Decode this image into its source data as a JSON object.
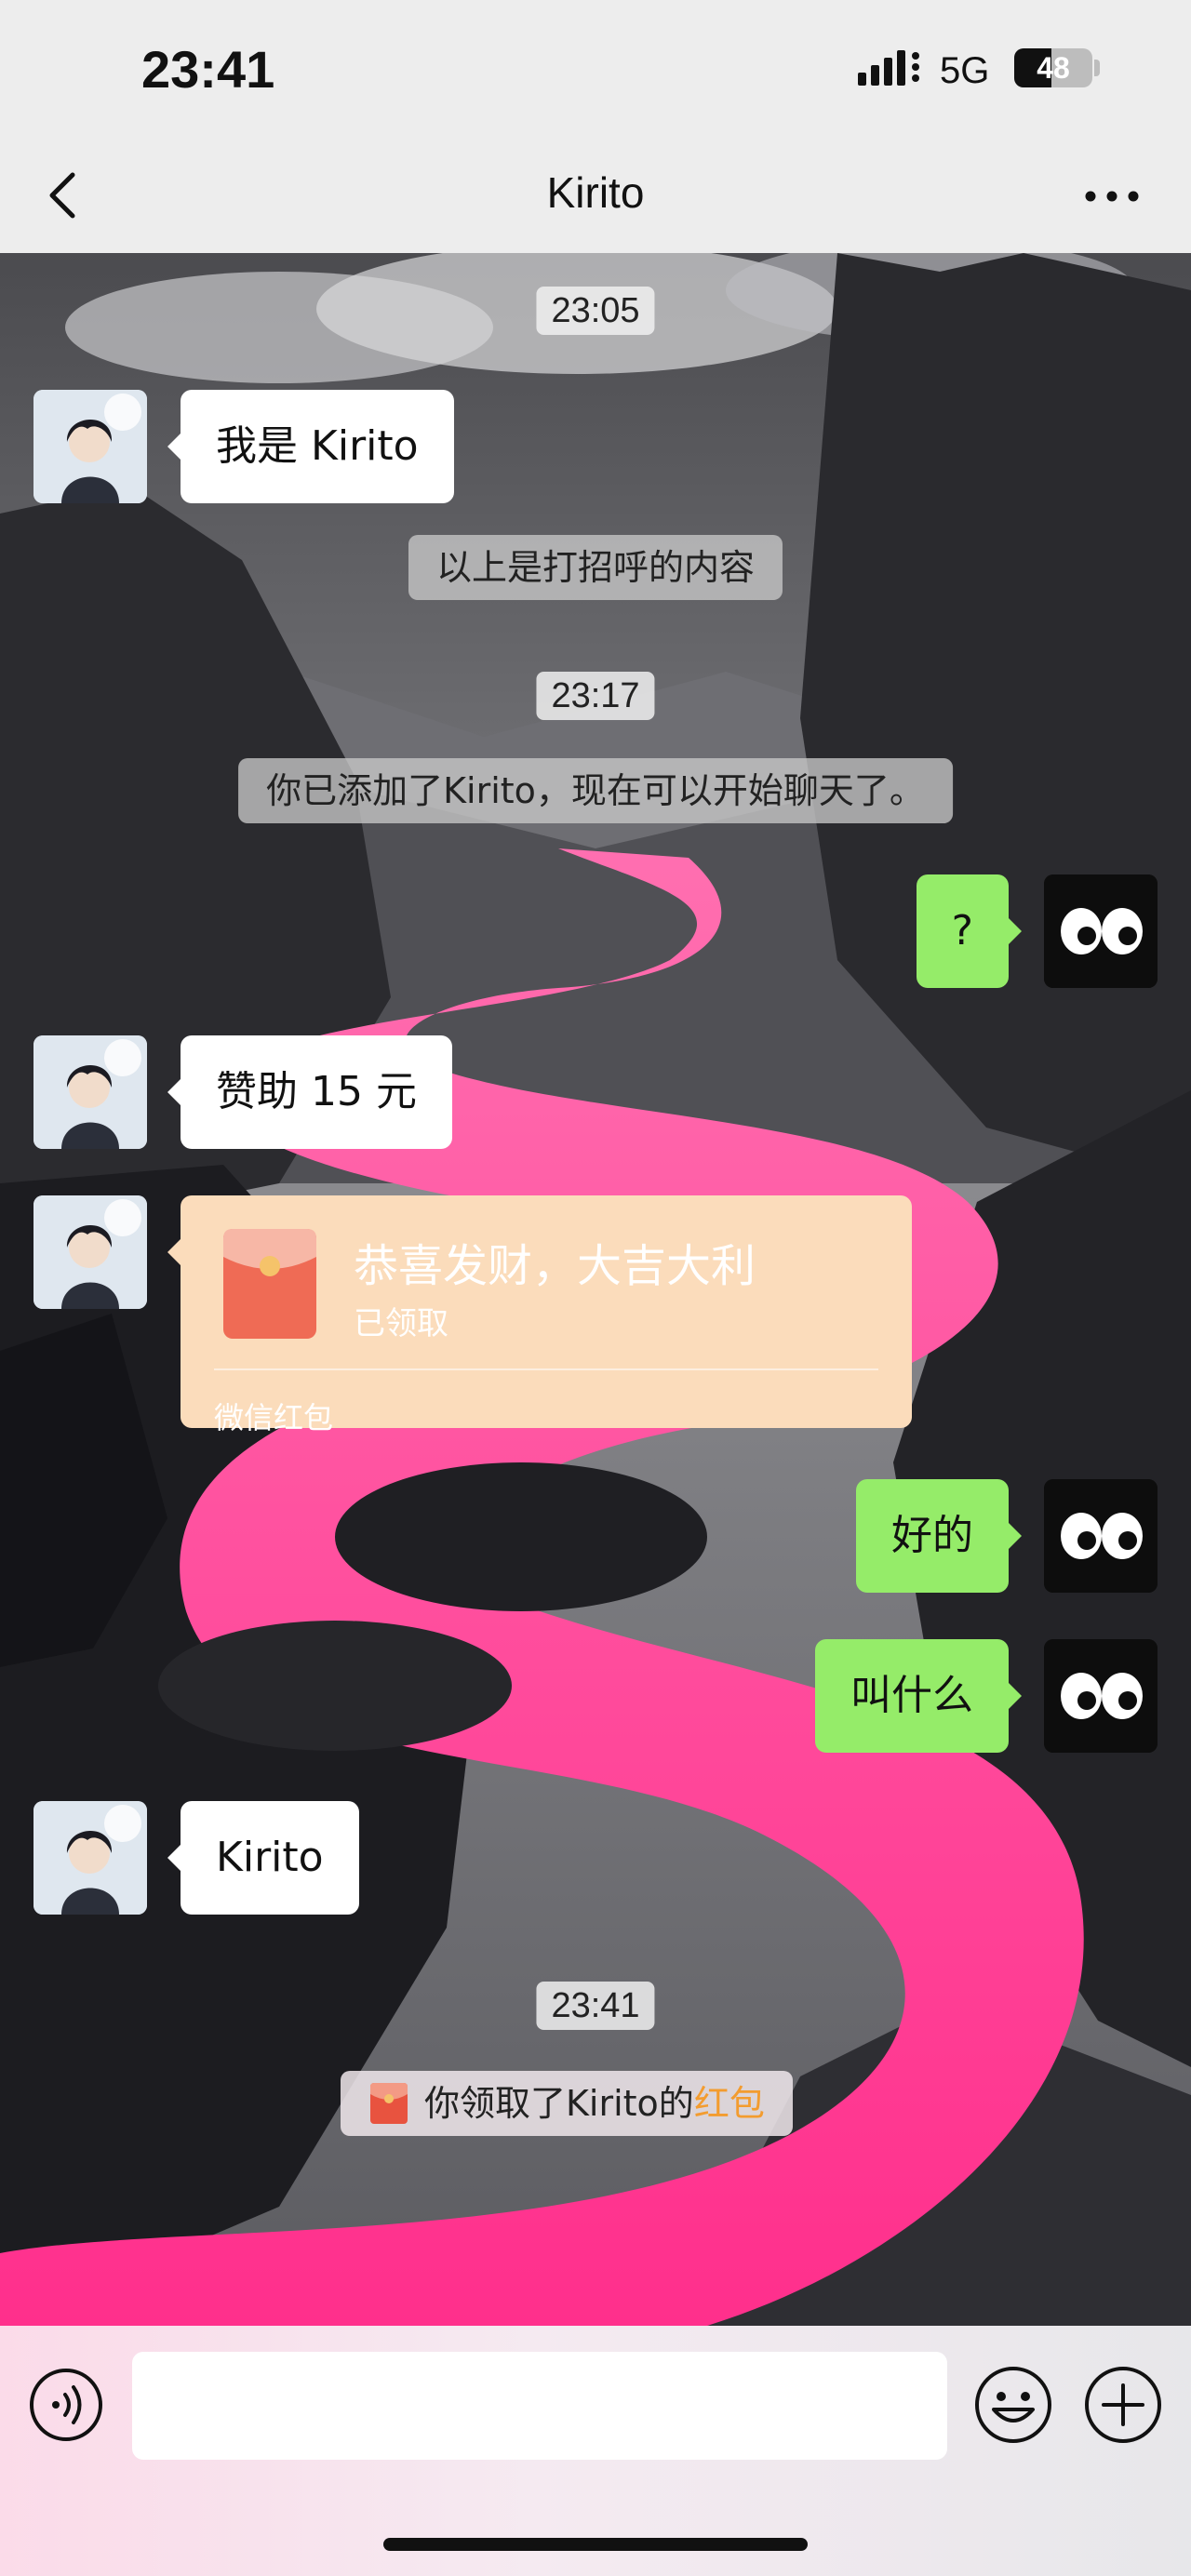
{
  "status_bar": {
    "time": "23:41",
    "network": "5G",
    "battery": "48",
    "battery_level": 0.48
  },
  "header": {
    "back_icon": "chevron-left-icon",
    "title": "Kirito",
    "more_icon": "more-icon"
  },
  "chat": {
    "messages": [
      {
        "kind": "time",
        "text": "23:05"
      },
      {
        "kind": "incoming",
        "text": "我是 Kirito"
      },
      {
        "kind": "system",
        "text": "以上是打招呼的内容"
      },
      {
        "kind": "time",
        "text": "23:17"
      },
      {
        "kind": "system",
        "text": "你已添加了Kirito，现在可以开始聊天了。"
      },
      {
        "kind": "outgoing",
        "text": "?"
      },
      {
        "kind": "incoming",
        "text": "赞助 15 元"
      },
      {
        "kind": "red_packet",
        "title": "恭喜发财，大吉大利",
        "status": "已领取",
        "footer": "微信红包"
      },
      {
        "kind": "outgoing",
        "text": "好的"
      },
      {
        "kind": "outgoing",
        "text": "叫什么"
      },
      {
        "kind": "incoming",
        "text": "Kirito"
      },
      {
        "kind": "time",
        "text": "23:41"
      },
      {
        "kind": "notice",
        "text": "你领取了Kirito的",
        "link": "红包"
      }
    ]
  },
  "input_bar": {
    "voice_icon": "voice-icon",
    "emoji_icon": "emoji-icon",
    "plus_icon": "plus-icon"
  },
  "colors": {
    "outgoing_bubble": "#95ec69",
    "incoming_bubble": "#ffffff",
    "red_packet": "#fbdcbb",
    "link": "#f39c2f"
  }
}
